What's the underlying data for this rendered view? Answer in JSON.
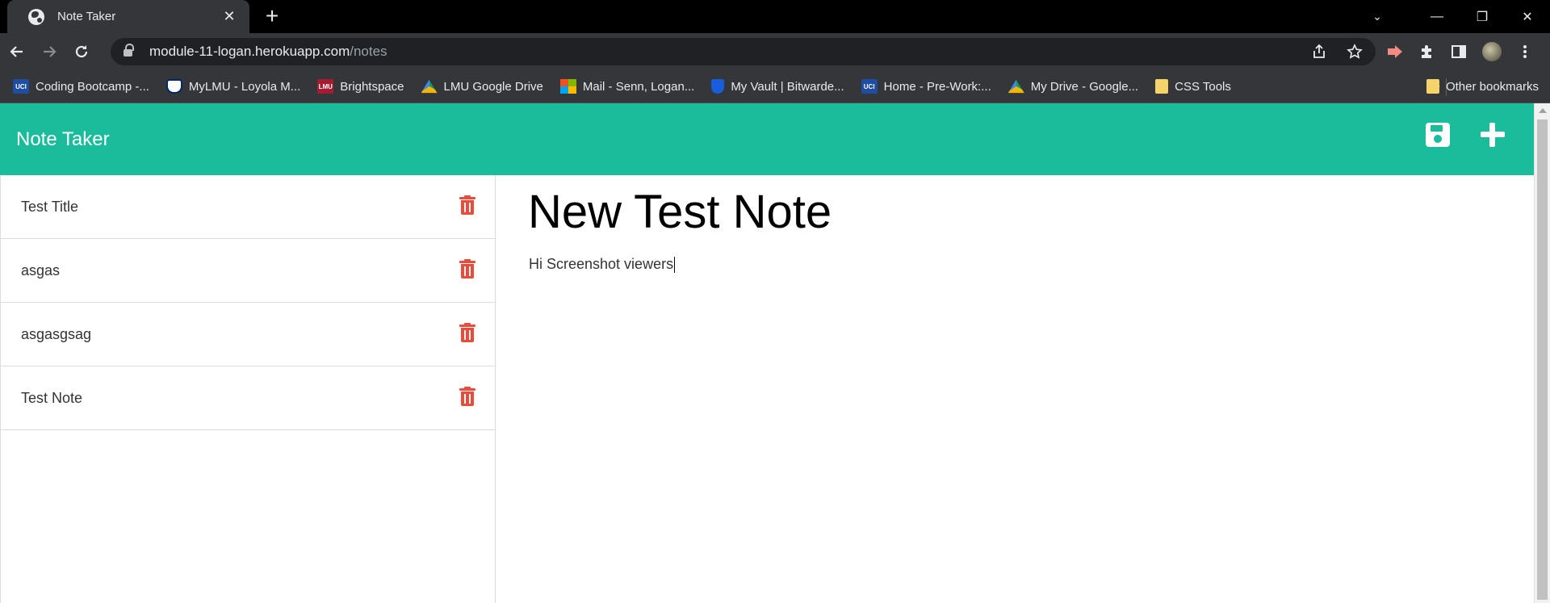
{
  "browser": {
    "tab_title": "Note Taker",
    "tab_close": "✕",
    "new_tab": "+",
    "window_controls": {
      "dropdown": "⌄",
      "minimize": "—",
      "restore": "❐",
      "close": "✕"
    },
    "url_host": "module-11-logan.herokuapp.com",
    "url_path": "/notes",
    "bookmarks": [
      {
        "label": "Coding Bootcamp -...",
        "icon": "uci-icon",
        "abbr": "UCI"
      },
      {
        "label": "MyLMU - Loyola M...",
        "icon": "lmu-shield-icon",
        "abbr": ""
      },
      {
        "label": "Brightspace",
        "icon": "brightspace-icon",
        "abbr": "LMU"
      },
      {
        "label": "LMU Google Drive",
        "icon": "google-drive-icon",
        "abbr": ""
      },
      {
        "label": "Mail - Senn, Logan...",
        "icon": "microsoft-icon",
        "abbr": ""
      },
      {
        "label": "My Vault | Bitwarde...",
        "icon": "bitwarden-icon",
        "abbr": ""
      },
      {
        "label": "Home - Pre-Work:...",
        "icon": "uci-icon",
        "abbr": "UCI"
      },
      {
        "label": "My Drive - Google...",
        "icon": "google-drive-icon",
        "abbr": ""
      },
      {
        "label": "CSS Tools",
        "icon": "folder-icon",
        "abbr": ""
      }
    ],
    "bookmarks_more": "»",
    "other_bookmarks": "Other bookmarks"
  },
  "app": {
    "brand": "Note Taker",
    "accent_color": "#1abc9c",
    "delete_color": "#e74c3c",
    "notes": [
      {
        "title": "Test Title"
      },
      {
        "title": "asgas"
      },
      {
        "title": "asgasgsag"
      },
      {
        "title": "Test Note"
      }
    ],
    "editor": {
      "title": "New Test Note",
      "body": "Hi Screenshot viewers"
    }
  }
}
